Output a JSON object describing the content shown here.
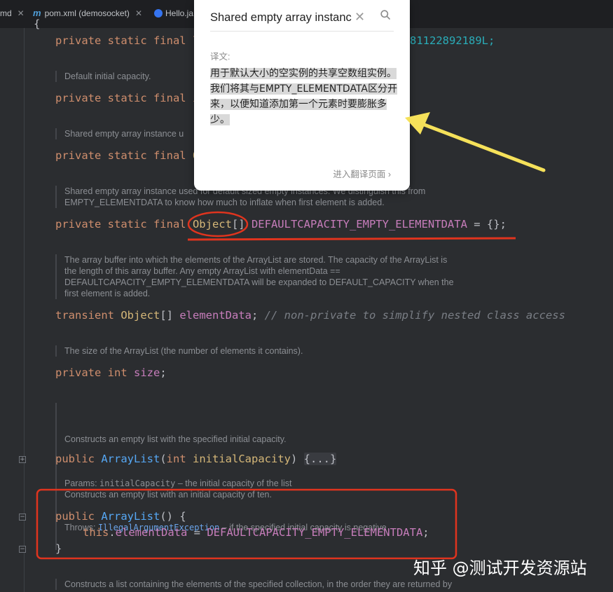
{
  "tabs": [
    {
      "label": "md"
    },
    {
      "label": "pom.xml (demosocket)"
    },
    {
      "label": "Hello.ja"
    }
  ],
  "popup": {
    "search_value": "Shared empty array instance",
    "label": "译文:",
    "translation": "用于默认大小的空实例的共享空数组实例。我们将其与EMPTY_ELEMENTDATA区分开来，以便知道添加第一个元素时要膨胀多少。",
    "more_link": "进入翻译页面 ›"
  },
  "code": {
    "brace_open": "{",
    "serial_kw": "private static final ",
    "serial_type": "l",
    "serial_tail": "81122892189L;",
    "doc1": "Default initial capacity.",
    "line2_kw": "private static final ",
    "line2_tail": "i",
    "doc2": "Shared empty array instance u",
    "line3_kw": "private static final ",
    "line3_tail": "O",
    "doc3_line1": "Shared empty array instance used for default sized empty instances. We distinguish this from",
    "doc3_line2": "EMPTY_ELEMENTDATA to know how much to inflate when first element is added.",
    "line4_kw": "private static final ",
    "line4_type": "Object",
    "line4_brackets": "[]",
    "line4_field": " DEFAULTCAPACITY_EMPTY_ELEMENTDATA",
    "line4_tail": " = {};",
    "doc4_line1": "The array buffer into which the elements of the ArrayList are stored. The capacity of the ArrayList is",
    "doc4_line2": "the length of this array buffer. Any empty ArrayList with elementData ==",
    "doc4_line3": "DEFAULTCAPACITY_EMPTY_ELEMENTDATA will be expanded to DEFAULT_CAPACITY when the",
    "doc4_line4": "first element is added.",
    "line5_kw": "transient ",
    "line5_type": "Object",
    "line5_brackets": "[] ",
    "line5_field": "elementData",
    "line5_semi": "; ",
    "line5_comment": "// non-private to simplify nested class access",
    "doc5": "The size of the ArrayList (the number of elements it contains).",
    "line6_kw": "private int ",
    "line6_field": "size",
    "line6_semi": ";",
    "doc6_line1": "Constructs an empty list with the specified initial capacity.",
    "doc6_params_label": "Params: ",
    "doc6_params_name": "initialCapacity",
    "doc6_params_desc": " – the initial capacity of the list",
    "doc6_throws_label": "Throws: ",
    "doc6_throws_name": "IllegalArgumentException",
    "doc6_throws_desc": " – if the specified initial capacity is negative",
    "line7_kw": "public ",
    "line7_fn": "ArrayList",
    "line7_paren": "(",
    "line7_int": "int ",
    "line7_param": "initialCapacity",
    "line7_close": ") ",
    "line7_fold": "{...}",
    "doc7": "Constructs an empty list with an initial capacity of ten.",
    "line8_kw": "public ",
    "line8_fn": "ArrayList",
    "line8_tail": "() {",
    "line9_this": "this",
    "line9_dot": ".",
    "line9_field": "elementData",
    "line9_eq": " = ",
    "line9_const": "DEFAULTCAPACITY_EMPTY_ELEMENTDATA",
    "line9_semi": ";",
    "line10": "}",
    "doc8": "Constructs a list containing the elements of the specified collection, in the order they are returned by"
  },
  "watermark": "知乎 @测试开发资源站",
  "colors": {
    "annotation": "#e0341e",
    "arrow": "#f5e15a"
  }
}
